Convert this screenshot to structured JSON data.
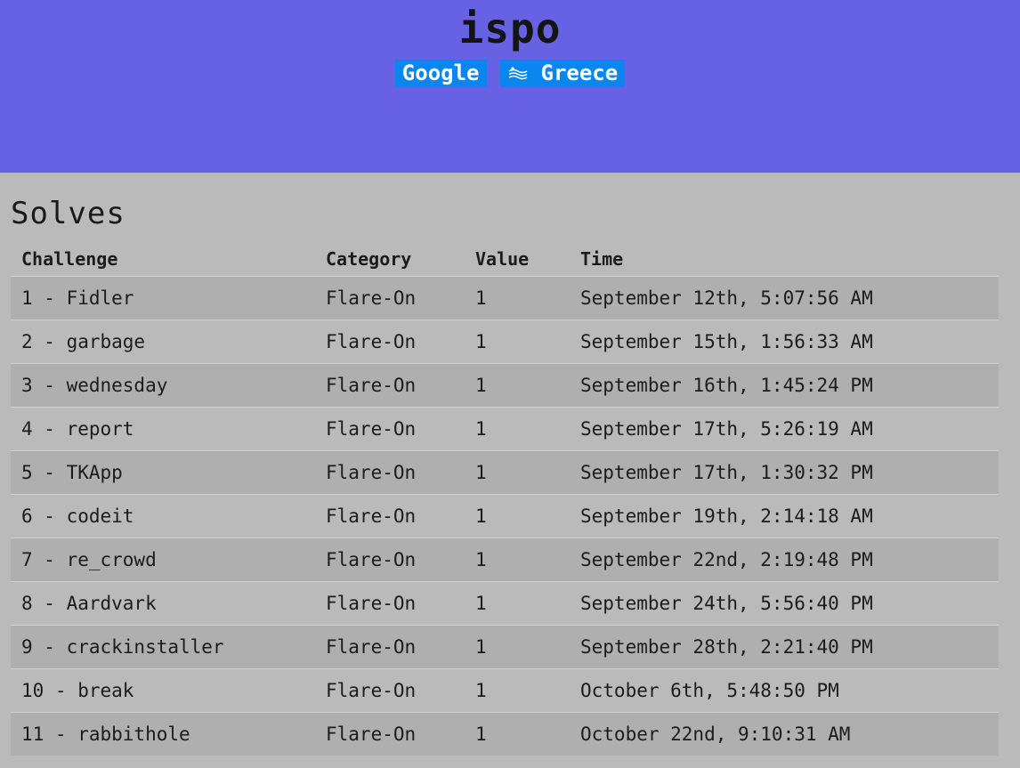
{
  "team": {
    "name": "ispo",
    "affiliation": "Google",
    "country": "Greece",
    "country_flag_icon": "greece-flag-icon"
  },
  "colors": {
    "hero_bg": "#6761e3",
    "tag_bg": "#0a86ee",
    "page_bg": "#bababa",
    "row_alt_bg": "#afafaf"
  },
  "solves": {
    "heading": "Solves",
    "columns": [
      "Challenge",
      "Category",
      "Value",
      "Time"
    ],
    "rows": [
      {
        "challenge": "1 - Fidler",
        "category": "Flare-On",
        "value": "1",
        "time": "September 12th, 5:07:56 AM"
      },
      {
        "challenge": "2 - garbage",
        "category": "Flare-On",
        "value": "1",
        "time": "September 15th, 1:56:33 AM"
      },
      {
        "challenge": "3 - wednesday",
        "category": "Flare-On",
        "value": "1",
        "time": "September 16th, 1:45:24 PM"
      },
      {
        "challenge": "4 - report",
        "category": "Flare-On",
        "value": "1",
        "time": "September 17th, 5:26:19 AM"
      },
      {
        "challenge": "5 - TKApp",
        "category": "Flare-On",
        "value": "1",
        "time": "September 17th, 1:30:32 PM"
      },
      {
        "challenge": "6 - codeit",
        "category": "Flare-On",
        "value": "1",
        "time": "September 19th, 2:14:18 AM"
      },
      {
        "challenge": "7 - re_crowd",
        "category": "Flare-On",
        "value": "1",
        "time": "September 22nd, 2:19:48 PM"
      },
      {
        "challenge": "8 - Aardvark",
        "category": "Flare-On",
        "value": "1",
        "time": "September 24th, 5:56:40 PM"
      },
      {
        "challenge": "9 - crackinstaller",
        "category": "Flare-On",
        "value": "1",
        "time": "September 28th, 2:21:40 PM"
      },
      {
        "challenge": "10 - break",
        "category": "Flare-On",
        "value": "1",
        "time": "October 6th, 5:48:50 PM"
      },
      {
        "challenge": "11 - rabbithole",
        "category": "Flare-On",
        "value": "1",
        "time": "October 22nd, 9:10:31 AM"
      }
    ]
  }
}
